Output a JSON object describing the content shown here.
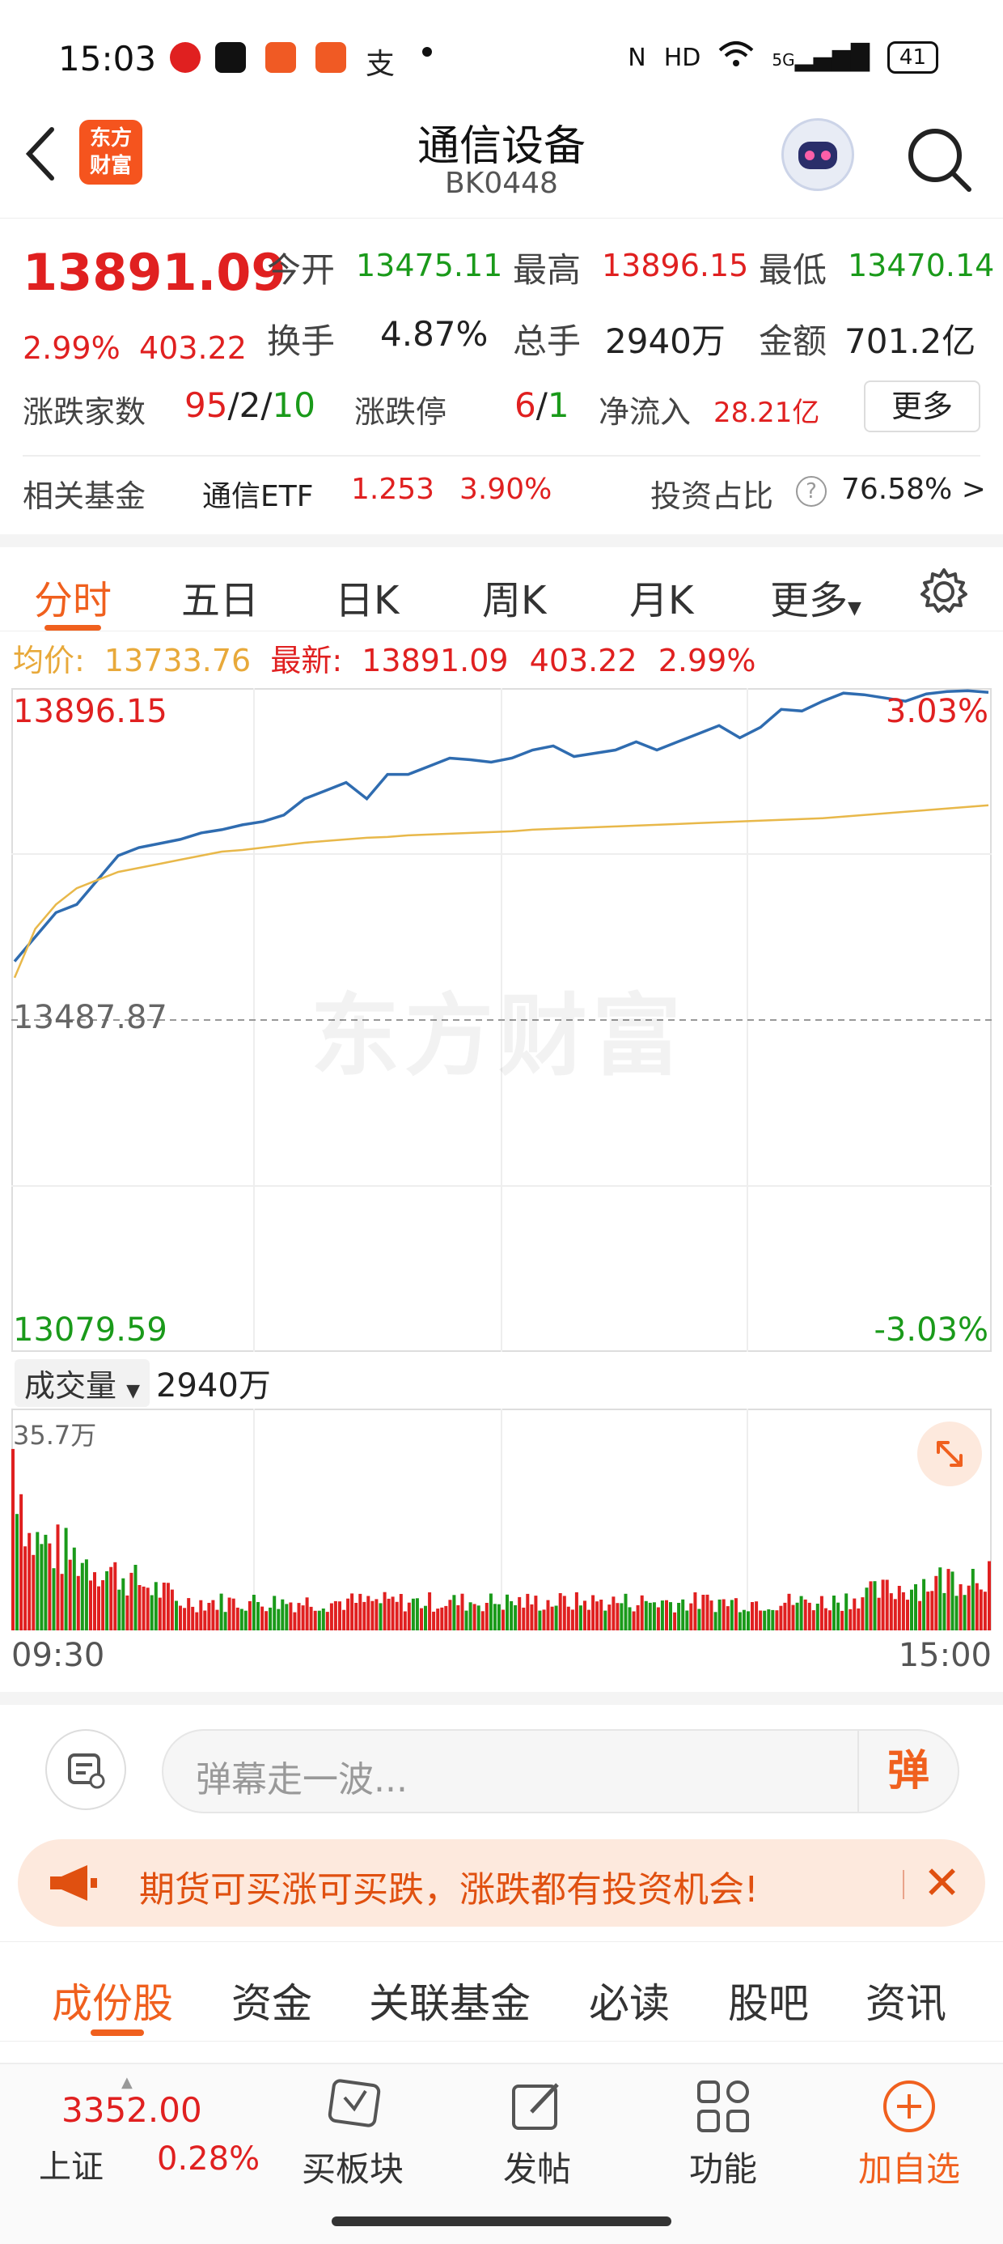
{
  "status_bar": {
    "time": "15:03",
    "net": "HD",
    "signal": "5G",
    "battery": "41"
  },
  "header": {
    "logo_text_line1": "东方",
    "logo_text_line2": "财富",
    "title": "通信设备",
    "code": "BK0448"
  },
  "quote": {
    "price": "13891.09",
    "change_pct": "2.99%",
    "change": "403.22",
    "open_label": "今开",
    "open": "13475.11",
    "high_label": "最高",
    "high": "13896.15",
    "low_label": "最低",
    "low": "13470.14",
    "turnover_label": "换手",
    "turnover": "4.87%",
    "volume_label": "总手",
    "volume": "2940万",
    "amount_label": "金额",
    "amount": "701.2亿",
    "breadth_label": "涨跌家数",
    "breadth_up": "95",
    "breadth_flat": "/2/",
    "breadth_down": "10",
    "limit_label": "涨跌停",
    "limit_up": "6",
    "limit_sep": "/",
    "limit_down": "1",
    "inflow_label": "净流入",
    "inflow": "28.21亿",
    "more": "更多",
    "fund_label": "相关基金",
    "fund_name": "通信ETF",
    "fund_price": "1.253",
    "fund_pct": "3.90%",
    "invest_label": "投资占比",
    "invest_value": "76.58% >"
  },
  "chart_tabs": [
    "分时",
    "五日",
    "日K",
    "周K",
    "月K",
    "更多"
  ],
  "avg_row": {
    "avg_label": "均价:",
    "avg_value": "13733.76",
    "latest_label": "最新:",
    "latest_value": "13891.09",
    "latest_change": "403.22",
    "latest_pct": "2.99%"
  },
  "chart_data": {
    "type": "line",
    "title": "",
    "x_labels": [
      "09:30",
      "15:00"
    ],
    "ylim": [
      13079.59,
      13896.15
    ],
    "y_top_label": "13896.15",
    "y_mid_label": "13487.87",
    "y_bottom_label": "13079.59",
    "pct_top": "3.03%",
    "pct_bottom": "-3.03%",
    "series": [
      {
        "name": "",
        "color": "#2f6cb0",
        "values": [
          13560,
          13590,
          13620,
          13630,
          13660,
          13690,
          13700,
          13705,
          13710,
          13718,
          13722,
          13728,
          13732,
          13740,
          13760,
          13770,
          13780,
          13760,
          13790,
          13790,
          13800,
          13810,
          13808,
          13805,
          13810,
          13820,
          13825,
          13812,
          13816,
          13820,
          13830,
          13820,
          13830,
          13840,
          13850,
          13835,
          13848,
          13870,
          13868,
          13880,
          13890,
          13888,
          13884,
          13880,
          13889,
          13892,
          13893,
          13891
        ]
      },
      {
        "name": "",
        "color": "#e8b84a",
        "values": [
          13540,
          13600,
          13630,
          13650,
          13660,
          13670,
          13675,
          13680,
          13685,
          13690,
          13695,
          13697,
          13700,
          13703,
          13706,
          13708,
          13710,
          13712,
          13713,
          13715,
          13716,
          13717,
          13718,
          13719,
          13720,
          13722,
          13723,
          13724,
          13725,
          13726,
          13727,
          13728,
          13729,
          13730,
          13731,
          13732,
          13733,
          13734,
          13735,
          13736,
          13738,
          13740,
          13742,
          13744,
          13746,
          13748,
          13750,
          13752
        ]
      }
    ]
  },
  "volume": {
    "selector": "成交量",
    "value": "2940万",
    "max_label": "35.7万"
  },
  "comment": {
    "placeholder": "弹幕走一波...",
    "danmu": "弹"
  },
  "banner": {
    "text": "期货可买涨可买跌，涨跌都有投资机会!"
  },
  "bottom_tabs": [
    "成份股",
    "资金",
    "关联基金",
    "必读",
    "股吧",
    "资讯"
  ],
  "toolbar": {
    "index_value": "3352.00",
    "index_name": "上证",
    "index_pct": "0.28%",
    "buy": "买板块",
    "post": "发帖",
    "func": "功能",
    "add": "加自选"
  }
}
